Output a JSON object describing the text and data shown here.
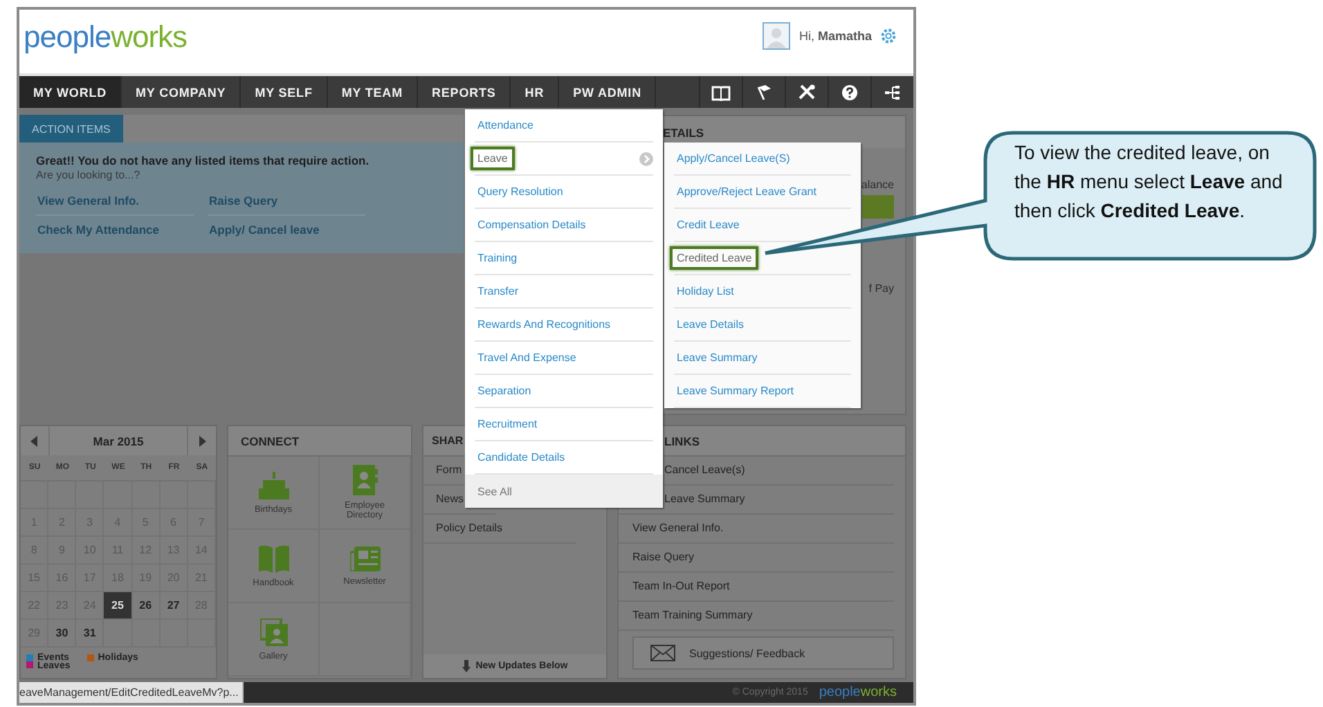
{
  "header": {
    "logo": {
      "first": "people",
      "second": "works"
    },
    "greeting": "Hi, **Mamatha**"
  },
  "nav": [
    {
      "label": "MY WORLD",
      "selected": true
    },
    {
      "label": "MY COMPANY",
      "selected": false
    },
    {
      "label": "MY SELF",
      "selected": false
    },
    {
      "label": "MY TEAM",
      "selected": false
    },
    {
      "label": "REPORTS",
      "selected": false
    },
    {
      "label": "HR",
      "selected": false
    },
    {
      "label": "PW ADMIN",
      "selected": false
    }
  ],
  "action_items": {
    "tab": "ACTION ITEMS",
    "message": "Great!! You do not have any listed items that require action.",
    "prompt": "Are you looking to...?",
    "links": [
      "View General Info.",
      "Raise Query",
      "Check My Attendance",
      "Apply/ Cancel leave"
    ]
  },
  "details_panel": {
    "title": "ETAILS",
    "label_1": "alance",
    "label_2": "f Pay"
  },
  "calendar": {
    "month": "Mar 2015",
    "weekdays": [
      "SU",
      "MO",
      "TU",
      "WE",
      "TH",
      "FR",
      "SA"
    ],
    "weeks": [
      [
        {
          "day": "1",
          "muted": true,
          "selected": false
        },
        {
          "day": "2",
          "muted": true,
          "selected": false
        },
        {
          "day": "3",
          "muted": true,
          "selected": false
        },
        {
          "day": "4",
          "muted": true,
          "selected": false
        },
        {
          "day": "5",
          "muted": true,
          "selected": false
        },
        {
          "day": "6",
          "muted": true,
          "selected": false
        },
        {
          "day": "7",
          "muted": true,
          "selected": false
        }
      ],
      [
        {
          "day": "8",
          "muted": true,
          "selected": false
        },
        {
          "day": "9",
          "muted": true,
          "selected": false
        },
        {
          "day": "10",
          "muted": true,
          "selected": false
        },
        {
          "day": "11",
          "muted": true,
          "selected": false
        },
        {
          "day": "12",
          "muted": true,
          "selected": false
        },
        {
          "day": "13",
          "muted": true,
          "selected": false
        },
        {
          "day": "14",
          "muted": true,
          "selected": false
        }
      ],
      [
        {
          "day": "15",
          "muted": true,
          "selected": false
        },
        {
          "day": "16",
          "muted": true,
          "selected": false
        },
        {
          "day": "17",
          "muted": true,
          "selected": false
        },
        {
          "day": "18",
          "muted": true,
          "selected": false
        },
        {
          "day": "19",
          "muted": true,
          "selected": false
        },
        {
          "day": "20",
          "muted": true,
          "selected": false
        },
        {
          "day": "21",
          "muted": true,
          "selected": false
        }
      ],
      [
        {
          "day": "22",
          "muted": true,
          "selected": false
        },
        {
          "day": "23",
          "muted": true,
          "selected": false
        },
        {
          "day": "24",
          "muted": true,
          "selected": false
        },
        {
          "day": "25",
          "muted": false,
          "selected": true
        },
        {
          "day": "26",
          "muted": false,
          "selected": false
        },
        {
          "day": "27",
          "muted": false,
          "selected": false
        },
        {
          "day": "28",
          "muted": true,
          "selected": false
        }
      ],
      [
        {
          "day": "29",
          "muted": true,
          "selected": false
        },
        {
          "day": "30",
          "muted": false,
          "selected": false
        },
        {
          "day": "31",
          "muted": false,
          "selected": false
        }
      ]
    ],
    "legend": [
      {
        "items": [
          {
            "label": "Events",
            "color": "#1f7fb6"
          },
          {
            "label": "Leaves",
            "color": "#b5166f"
          }
        ]
      },
      {
        "items": [
          {
            "label": "Holidays",
            "color": "#b3560f"
          }
        ]
      }
    ]
  },
  "connect": {
    "title": "CONNECT",
    "tiles": [
      {
        "label": "Birthdays",
        "kind": "cake"
      },
      {
        "label": "Employee Directory",
        "kind": "directory"
      },
      {
        "label": "Handbook",
        "kind": "handbook"
      },
      {
        "label": "Newsletter",
        "kind": "newsletter"
      },
      {
        "label": "Gallery",
        "kind": "gallery"
      }
    ]
  },
  "shared": {
    "title": "SHAR",
    "items": [
      "Form",
      "News",
      "Policy Details"
    ],
    "footer": "New Updates Below"
  },
  "quick_links": {
    "title": "LINKS",
    "items": [
      "Cancel Leave(s)",
      "Leave Summary",
      "View General Info.",
      "Raise Query",
      "Team In-Out Report",
      "Team Training Summary"
    ],
    "feedback": "Suggestions/ Feedback"
  },
  "hr_menu": [
    {
      "label": "Attendance",
      "selected": false,
      "submenu": false,
      "kind": "item"
    },
    {
      "label": "Leave",
      "selected": true,
      "submenu": true,
      "kind": "item"
    },
    {
      "label": "Query Resolution",
      "selected": false,
      "submenu": false,
      "kind": "item"
    },
    {
      "label": "Compensation Details",
      "selected": false,
      "submenu": false,
      "kind": "item"
    },
    {
      "label": "Training",
      "selected": false,
      "submenu": false,
      "kind": "item"
    },
    {
      "label": "Transfer",
      "selected": false,
      "submenu": false,
      "kind": "item"
    },
    {
      "label": "Rewards And Recognitions",
      "selected": false,
      "submenu": false,
      "kind": "item"
    },
    {
      "label": "Travel And Expense",
      "selected": false,
      "submenu": false,
      "kind": "item"
    },
    {
      "label": "Separation",
      "selected": false,
      "submenu": false,
      "kind": "item"
    },
    {
      "label": "Recruitment",
      "selected": false,
      "submenu": false,
      "kind": "item"
    },
    {
      "label": "Candidate Details",
      "selected": false,
      "submenu": false,
      "kind": "item"
    },
    {
      "label": "See All",
      "selected": false,
      "submenu": false,
      "kind": "footer"
    }
  ],
  "leave_submenu": [
    {
      "label": "Apply/Cancel Leave(S)",
      "selected": false
    },
    {
      "label": "Approve/Reject Leave Grant",
      "selected": false
    },
    {
      "label": "Credit Leave",
      "selected": false
    },
    {
      "label": "Credited Leave",
      "selected": true
    },
    {
      "label": "Holiday List",
      "selected": false
    },
    {
      "label": "Leave Details",
      "selected": false
    },
    {
      "label": "Leave Summary",
      "selected": false
    },
    {
      "label": "Leave Summary Report",
      "selected": false
    }
  ],
  "callout": {
    "text": "To view the credited leave, on the **HR** menu select **Leave** and then click **Credited Leave**."
  },
  "footer": {
    "status_url": "eaveManagement/EditCreditedLeaveMv?p...",
    "copyright": "© Copyright 2015",
    "logo": {
      "first": "people",
      "second": "works"
    }
  }
}
